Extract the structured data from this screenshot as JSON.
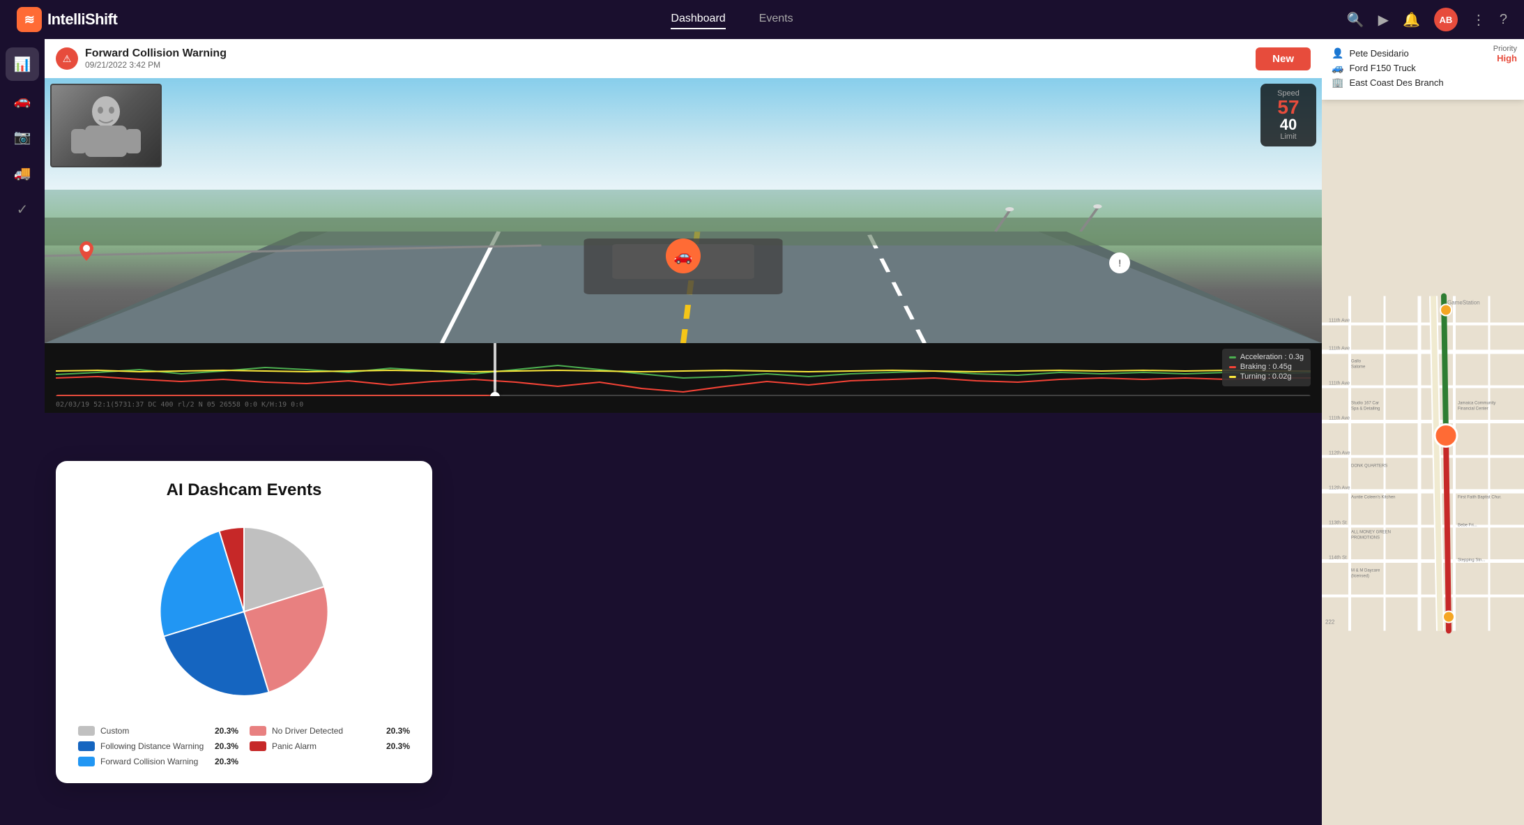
{
  "app": {
    "name": "IntelliShift",
    "logo_symbol": "≋"
  },
  "nav": {
    "items": [
      {
        "label": "Dashboard",
        "active": true
      },
      {
        "label": "Events",
        "active": false
      }
    ],
    "icons": [
      "search",
      "play",
      "bell",
      "more",
      "help"
    ],
    "avatar_initials": "AB"
  },
  "sidebar": {
    "items": [
      {
        "icon": "📊",
        "name": "analytics",
        "active": true
      },
      {
        "icon": "🚗",
        "name": "vehicles"
      },
      {
        "icon": "📷",
        "name": "camera"
      },
      {
        "icon": "🚚",
        "name": "fleet"
      },
      {
        "icon": "✓",
        "name": "check"
      }
    ]
  },
  "event": {
    "title": "Forward Collision Warning",
    "date": "09/21/2022 3:42 PM",
    "icon": "⚠"
  },
  "new_button": {
    "label": "New"
  },
  "speed": {
    "label": "Speed",
    "value": "57",
    "limit_value": "40",
    "limit_label": "Limit"
  },
  "sensor_graph": {
    "legend": [
      {
        "label": "Acceleration : 0.3g",
        "color": "#4caf50"
      },
      {
        "label": "Braking : 0.45g",
        "color": "#f44336"
      },
      {
        "label": "Turning : 0.02g",
        "color": "#ffeb3b"
      }
    ]
  },
  "map": {
    "driver_name": "Pete Desidario",
    "vehicle": "Ford F150 Truck",
    "branch": "East Coast Des Branch",
    "priority_label": "Priority",
    "priority_value": "High",
    "gamestation_label": "GameStation"
  },
  "pie_chart": {
    "title": "AI Dashcam Events",
    "segments": [
      {
        "label": "Custom",
        "color": "#c0c0c0",
        "pct": "20.3%",
        "value": 20.3,
        "start": 0
      },
      {
        "label": "No Driver Detected",
        "color": "#e88080",
        "pct": "20.3%",
        "value": 20.3,
        "start": 72
      },
      {
        "label": "Following Distance Warning",
        "color": "#1a6bbf",
        "pct": "20.3%",
        "value": 20.3,
        "start": 144
      },
      {
        "label": "Forward Collision Warning",
        "color": "#2196f3",
        "pct": "20.3%",
        "value": 20.3,
        "start": 216
      },
      {
        "label": "Panic Alarm",
        "color": "#c62828",
        "pct": "20.3%",
        "value": 20.3,
        "start": 288
      }
    ]
  },
  "timestamp": {
    "text": "02/03/19 52:1(5731:37 DC 400 rl/2 N 05 26558 0:0  K/H:19 0:0"
  }
}
